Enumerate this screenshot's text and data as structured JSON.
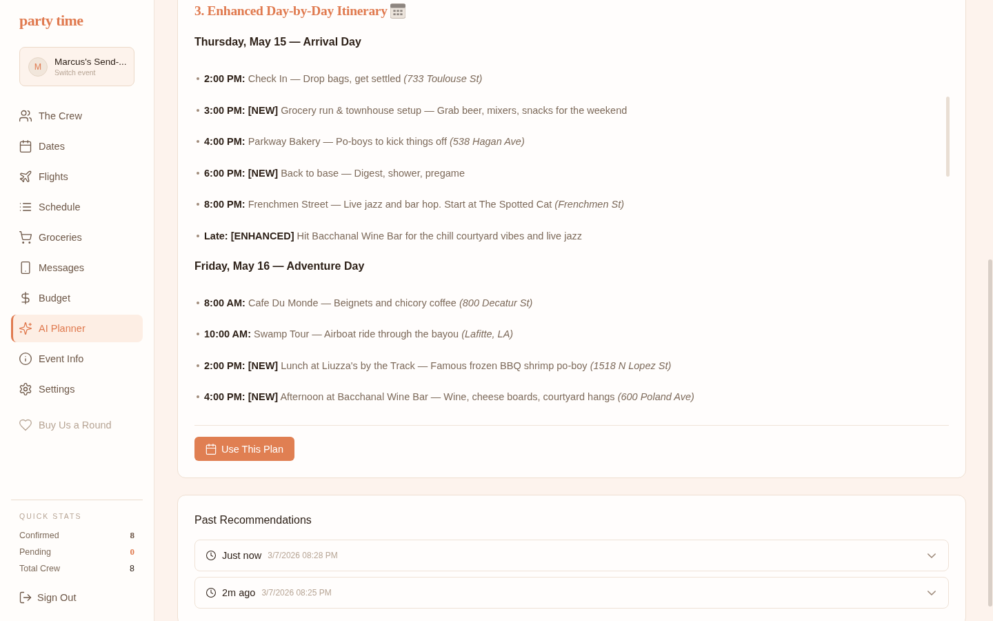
{
  "sidebar": {
    "logo": "party time",
    "event_switcher": {
      "avatar": "M",
      "name": "Marcus's Send-...",
      "hint": "Switch event"
    },
    "nav": [
      {
        "label": "The Crew",
        "selected": false
      },
      {
        "label": "Dates",
        "selected": false
      },
      {
        "label": "Flights",
        "selected": false
      },
      {
        "label": "Schedule",
        "selected": false
      },
      {
        "label": "Groceries",
        "selected": false
      },
      {
        "label": "Messages",
        "selected": false
      },
      {
        "label": "Budget",
        "selected": false
      },
      {
        "label": "AI Planner",
        "selected": true
      },
      {
        "label": "Event Info",
        "selected": false
      },
      {
        "label": "Settings",
        "selected": false
      }
    ],
    "support_link": "Buy Us a Round",
    "quick_stats": {
      "title": "QUICK STATS",
      "rows": [
        {
          "label": "Confirmed",
          "value": "8",
          "kind": "status",
          "color": "#6b5444"
        },
        {
          "label": "Pending",
          "value": "0",
          "kind": "status",
          "color": "#e07a4f"
        },
        {
          "label": "Total Crew",
          "value": "8",
          "kind": "total",
          "color": "#2d2017"
        }
      ]
    },
    "sign_out": "Sign Out"
  },
  "plan": {
    "heading": "3. Enhanced Day-by-Day Itinerary",
    "days": [
      {
        "title": "Thursday, May 15 — Arrival Day",
        "items": [
          "**2:00 PM:** Check In — Drop bags, get settled *(733 Toulouse St)*",
          "**3:00 PM: [NEW]** Grocery run & townhouse setup — Grab beer, mixers, snacks for the weekend",
          "**4:00 PM:** Parkway Bakery — Po-boys to kick things off *(538 Hagan Ave)*",
          "**6:00 PM: [NEW]** Back to base — Digest, shower, pregame",
          "**8:00 PM:** Frenchmen Street — Live jazz and bar hop. Start at The Spotted Cat *(Frenchmen St)*",
          "**Late: [ENHANCED]** Hit Bacchanal Wine Bar for the chill courtyard vibes and live jazz"
        ]
      },
      {
        "title": "Friday, May 16 — Adventure Day",
        "items": [
          "**8:00 AM:** Cafe Du Monde — Beignets and chicory coffee *(800 Decatur St)*",
          "**10:00 AM:** Swamp Tour — Airboat ride through the bayou *(Lafitte, LA)*",
          "**2:00 PM: [NEW]** Lunch at Liuzza's by the Track — Famous frozen BBQ shrimp po-boy *(1518 N Lopez St)*",
          "**4:00 PM: [NEW]** Afternoon at Bacchanal Wine Bar — Wine, cheese boards, courtyard hangs *(600 Poland Ave)*"
        ]
      }
    ],
    "button": "Use This Plan"
  },
  "past_recommendations": {
    "title": "Past Recommendations",
    "items": [
      {
        "label": "Just now",
        "timestamp": "3/7/2026 08:28 PM",
        "expanded": false
      },
      {
        "label": "2m ago",
        "timestamp": "3/7/2026 08:25 PM",
        "expanded": false
      }
    ]
  }
}
